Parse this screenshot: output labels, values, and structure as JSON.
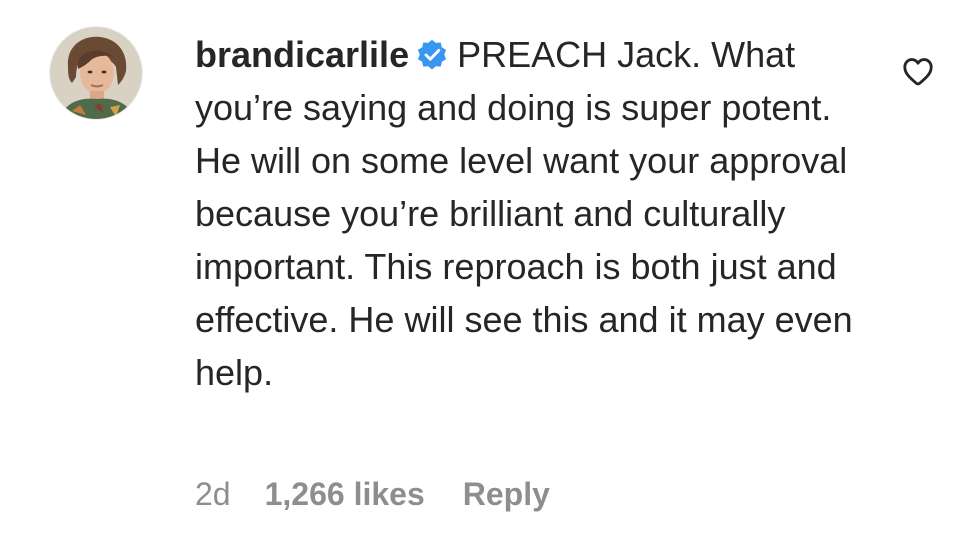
{
  "comment": {
    "avatar_icon": "profile-photo",
    "username": "brandicarlile",
    "verified_icon": "verified-badge-icon",
    "verified_color": "#3897f0",
    "text": "PREACH Jack. What you’re saying and doing is super potent. He will on some level want your approval because you’re brilliant and culturally important. This reproach is both just and effective. He will see this and it may even help.",
    "like_icon": "heart-outline-icon",
    "time": "2d",
    "likes": "1,266 likes",
    "reply_label": "Reply"
  }
}
